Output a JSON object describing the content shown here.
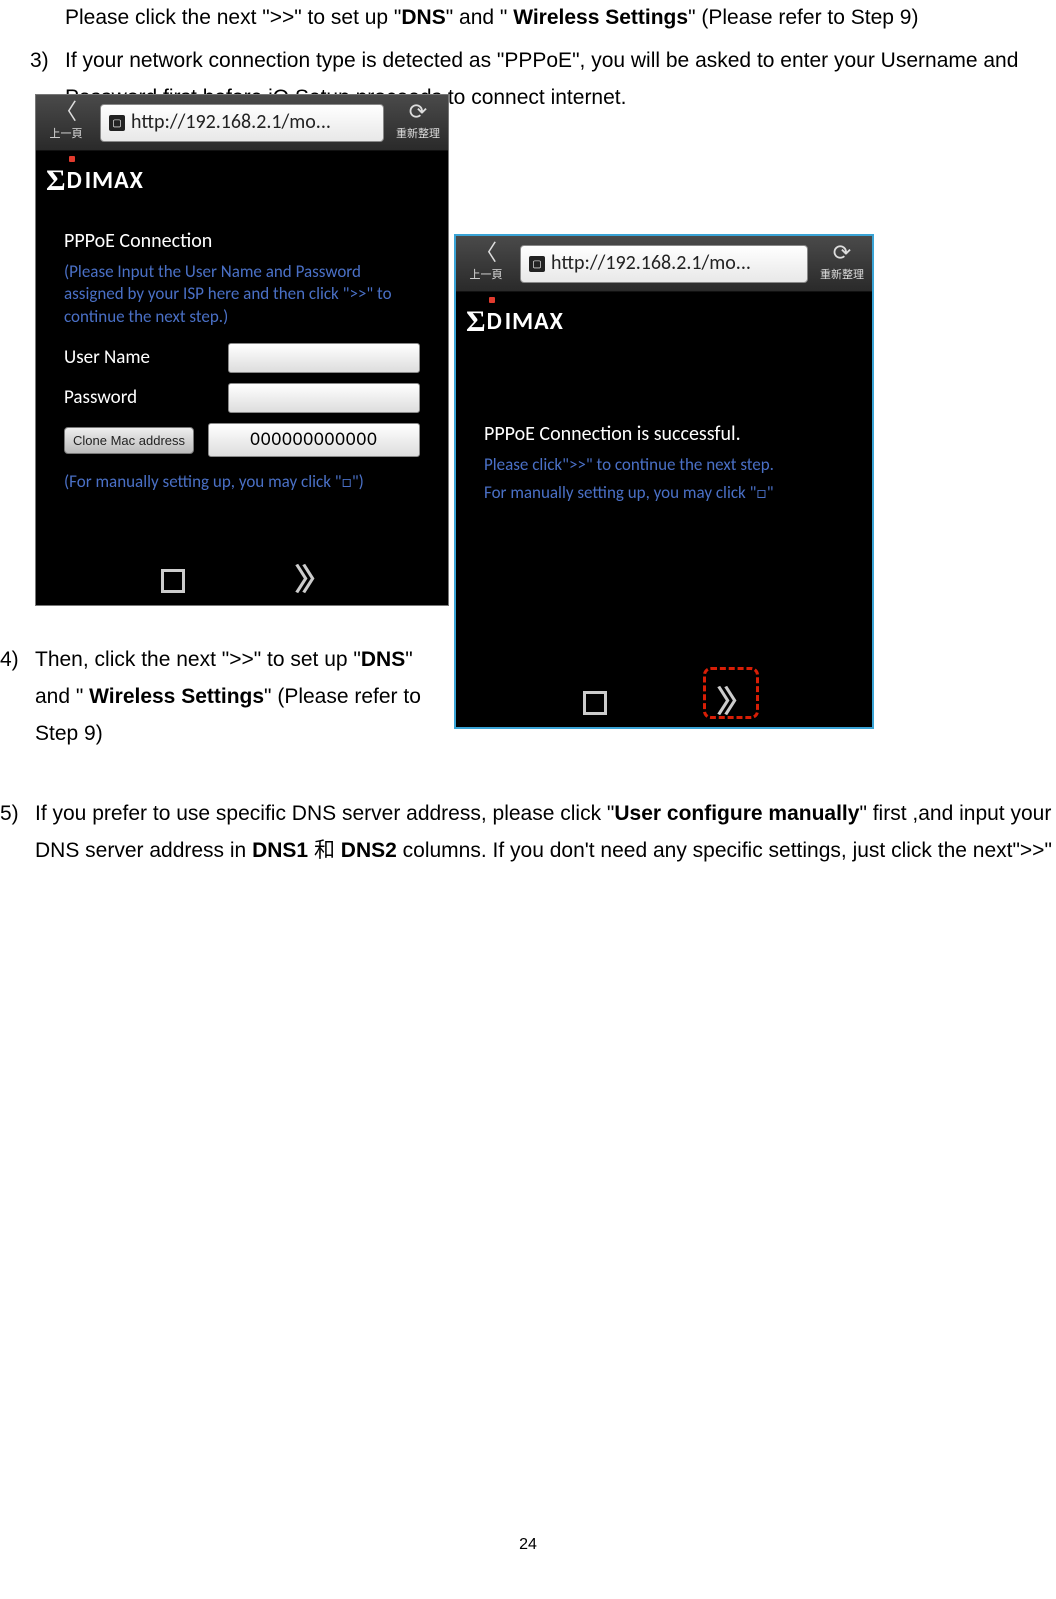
{
  "intro_prefix": "Please click the next \">>\" to set up \"",
  "intro_dns": "DNS",
  "intro_mid": "\" and \" ",
  "intro_ws": "Wireless Settings",
  "intro_suffix": "\" (Please refer to Step 9)",
  "step3": {
    "num": "3)",
    "text": "If your network connection type is detected as \"PPPoE\", you will be asked to enter your Username and Password first before iQ Setup proceeds to connect internet."
  },
  "phone_common": {
    "back_label": "上一頁",
    "refresh_label": "重新整理",
    "url": "http://192.168.2.1/mo...",
    "brand_letters": "DIMAX"
  },
  "phone1": {
    "title": "PPPoE Connection",
    "hint": "(Please Input the User Name and Password assigned by your ISP here and then click \">>\" to continue the next step.)",
    "label_user": "User Name",
    "label_pass": "Password",
    "clone_btn": "Clone Mac address",
    "mac": "000000000000",
    "manual_hint": "(For manually setting up, you may click \"□\")"
  },
  "phone2": {
    "title": "PPPoE Connection is successful.",
    "hint1": "Please click\">>\" to continue the next step.",
    "hint2": "For manually setting up, you may click \"□\""
  },
  "step4": {
    "num": "4)",
    "t1": "Then, click the next \">>\" to set up \"",
    "dns": "DNS",
    "t2": "\" and \" ",
    "ws": "Wireless Settings",
    "t3": "\" (Please refer to Step 9)"
  },
  "step5": {
    "num": "5)",
    "t1": "If you prefer to use specific DNS server address, please click \"",
    "ucm": "User configure manually",
    "t2": "\" first ,and input your DNS server address in ",
    "dns1": "DNS1",
    "he": " 和 ",
    "dns2": "DNS2",
    "t3": " columns. If you don't need any specific settings, just click the next\">>\""
  },
  "page_number": "24"
}
